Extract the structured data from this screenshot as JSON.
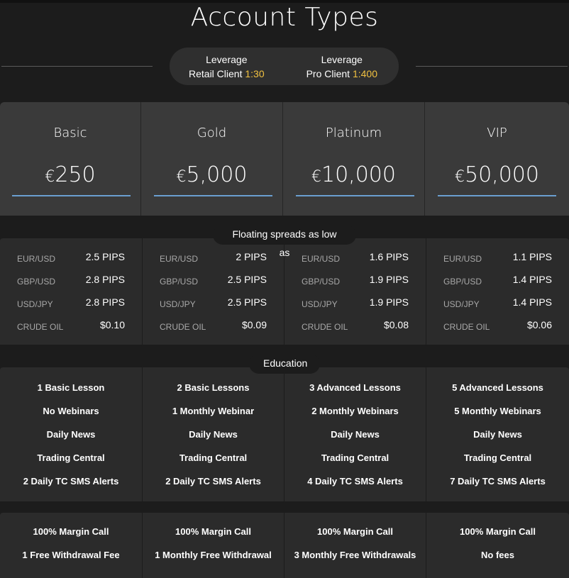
{
  "page": {
    "title": "Account Types"
  },
  "leverage": {
    "retail": {
      "label": "Leverage",
      "client": "Retail Client",
      "ratio": "1:30"
    },
    "pro": {
      "label": "Leverage",
      "client": "Pro Client",
      "ratio": "1:400"
    }
  },
  "accounts": [
    {
      "name": "Basic",
      "currency": "€",
      "amount": "250"
    },
    {
      "name": "Gold",
      "currency": "€",
      "amount": "5,000"
    },
    {
      "name": "Platinum",
      "currency": "€",
      "amount": "10,000"
    },
    {
      "name": "VIP",
      "currency": "€",
      "amount": "50,000"
    }
  ],
  "spreads": {
    "label": "Floating spreads as low as",
    "pairs": [
      "EUR/USD",
      "GBP/USD",
      "USD/JPY",
      "CRUDE OIL"
    ],
    "values": [
      [
        "2.5 PIPS",
        "2.8 PIPS",
        "2.8 PIPS",
        "$0.10"
      ],
      [
        "2 PIPS",
        "2.5 PIPS",
        "2.5 PIPS",
        "$0.09"
      ],
      [
        "1.6 PIPS",
        "1.9 PIPS",
        "1.9 PIPS",
        "$0.08"
      ],
      [
        "1.1 PIPS",
        "1.4 PIPS",
        "1.4 PIPS",
        "$0.06"
      ]
    ]
  },
  "education": {
    "label": "Education",
    "items": [
      [
        "1 Basic Lesson",
        "No Webinars",
        "Daily News",
        "Trading Central",
        "2 Daily TC SMS Alerts"
      ],
      [
        "2 Basic Lessons",
        "1 Monthly Webinar",
        "Daily News",
        "Trading Central",
        "2 Daily TC SMS Alerts"
      ],
      [
        "3 Advanced Lessons",
        "2 Monthly Webinars",
        "Daily News",
        "Trading Central",
        "4 Daily TC SMS Alerts"
      ],
      [
        "5 Advanced Lessons",
        "5 Monthly Webinars",
        "Daily News",
        "Trading Central",
        "7 Daily TC SMS Alerts"
      ]
    ]
  },
  "extras": [
    [
      "100% Margin Call",
      "1 Free Withdrawal Fee"
    ],
    [
      "100% Margin Call",
      "1 Monthly Free Withdrawal"
    ],
    [
      "100% Margin Call",
      "3 Monthly Free Withdrawals"
    ],
    [
      "100% Margin Call",
      "No fees"
    ]
  ],
  "colors": {
    "accent": "#f0c040",
    "underline": "#6a9fd0",
    "background": "#1c1c1c"
  }
}
